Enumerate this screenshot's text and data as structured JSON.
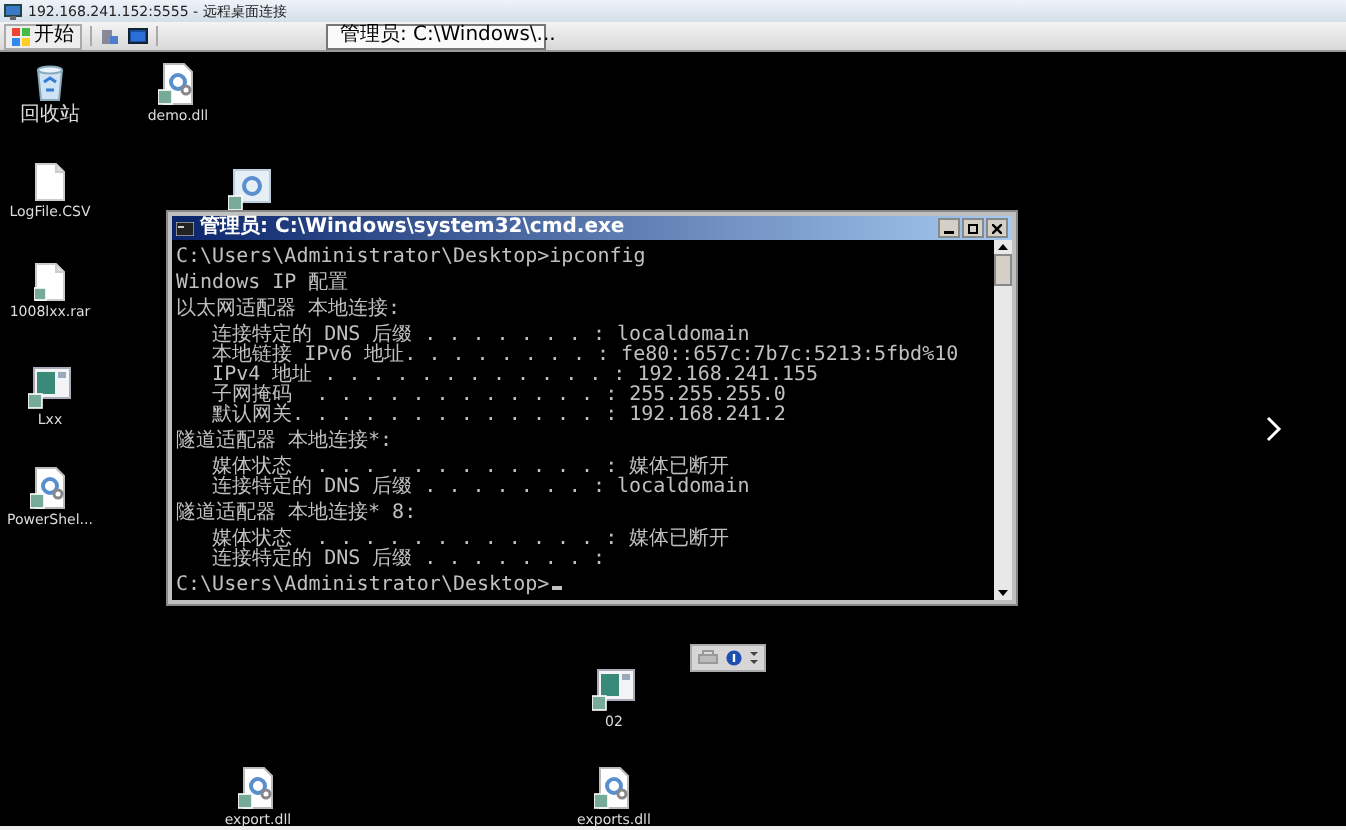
{
  "remote_window": {
    "title": "192.168.241.152:5555 - 远程桌面连接"
  },
  "taskbar": {
    "start_label": "开始",
    "tasks": [
      {
        "label": "管理员: C:\\Windows\\...",
        "selected": true
      }
    ]
  },
  "desktop_icons": [
    {
      "kind": "recycle-bin",
      "label": "回收站"
    },
    {
      "kind": "gear-file",
      "label": "demo.dll"
    },
    {
      "kind": "file",
      "label": "LogFile.CSV"
    },
    {
      "kind": "gear-window"
    },
    {
      "kind": "file",
      "label": "1008lxx.rar"
    },
    {
      "kind": "app-window",
      "label": "Lxx"
    },
    {
      "kind": "gear-file",
      "label": "PowerShel..."
    },
    {
      "kind": "app-window",
      "label": "02"
    },
    {
      "kind": "gear-file",
      "label": "export.dll"
    },
    {
      "kind": "gear-file",
      "label": "exports.dll"
    }
  ],
  "cmd_window": {
    "title": "管理员: C:\\Windows\\system32\\cmd.exe",
    "blocks": [
      [
        "C:\\Users\\Administrator\\Desktop>ipconfig"
      ],
      [
        "Windows IP 配置"
      ],
      [
        "以太网适配器 本地连接:"
      ],
      [
        "   连接特定的 DNS 后缀 . . . . . . . : localdomain",
        "   本地链接 IPv6 地址. . . . . . . . : fe80::657c:7b7c:5213:5fbd%10",
        "   IPv4 地址 . . . . . . . . . . . . : 192.168.241.155",
        "   子网掩码  . . . . . . . . . . . . : 255.255.255.0",
        "   默认网关. . . . . . . . . . . . . : 192.168.241.2"
      ],
      [
        "隧道适配器 本地连接*:"
      ],
      [
        "   媒体状态  . . . . . . . . . . . . : 媒体已断开",
        "   连接特定的 DNS 后缀 . . . . . . . : localdomain"
      ],
      [
        "隧道适配器 本地连接* 8:"
      ],
      [
        "   媒体状态  . . . . . . . . . . . . : 媒体已断开",
        "   连接特定的 DNS 后缀 . . . . . . . :"
      ],
      [
        "C:\\Users\\Administrator\\Desktop>"
      ]
    ]
  }
}
